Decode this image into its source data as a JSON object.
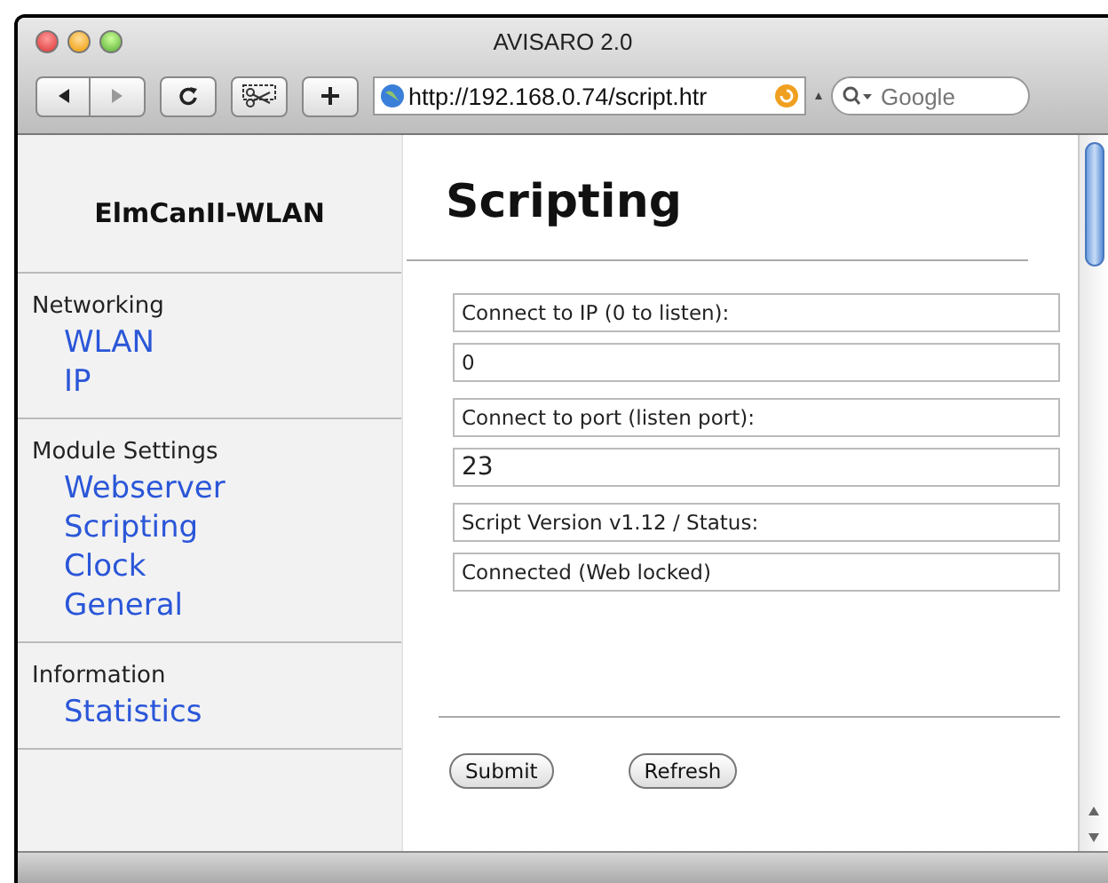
{
  "window": {
    "title": "AVISARO 2.0"
  },
  "toolbar": {
    "address": "http://192.168.0.74/script.htr",
    "search": {
      "placeholder": "Google"
    }
  },
  "sidebar": {
    "title": "ElmCanII-WLAN",
    "sections": [
      {
        "heading": "Networking",
        "items": [
          {
            "label": "WLAN"
          },
          {
            "label": "IP"
          }
        ]
      },
      {
        "heading": "Module Settings",
        "items": [
          {
            "label": "Webserver"
          },
          {
            "label": "Scripting"
          },
          {
            "label": "Clock"
          },
          {
            "label": "General"
          }
        ]
      },
      {
        "heading": "Information",
        "items": [
          {
            "label": "Statistics"
          }
        ]
      }
    ]
  },
  "page": {
    "heading": "Scripting",
    "fields": [
      {
        "kind": "label",
        "text": "Connect to IP (0 to listen):"
      },
      {
        "kind": "input",
        "value": "0",
        "large": false
      },
      {
        "kind": "label",
        "text": "Connect to port (listen port):"
      },
      {
        "kind": "input",
        "value": "23",
        "large": true
      },
      {
        "kind": "label",
        "text": "Script Version v1.12 / Status:"
      },
      {
        "kind": "input",
        "value": "Connected (Web locked)",
        "large": false
      }
    ],
    "buttons": [
      {
        "label": "Submit"
      },
      {
        "label": "Refresh"
      }
    ]
  }
}
